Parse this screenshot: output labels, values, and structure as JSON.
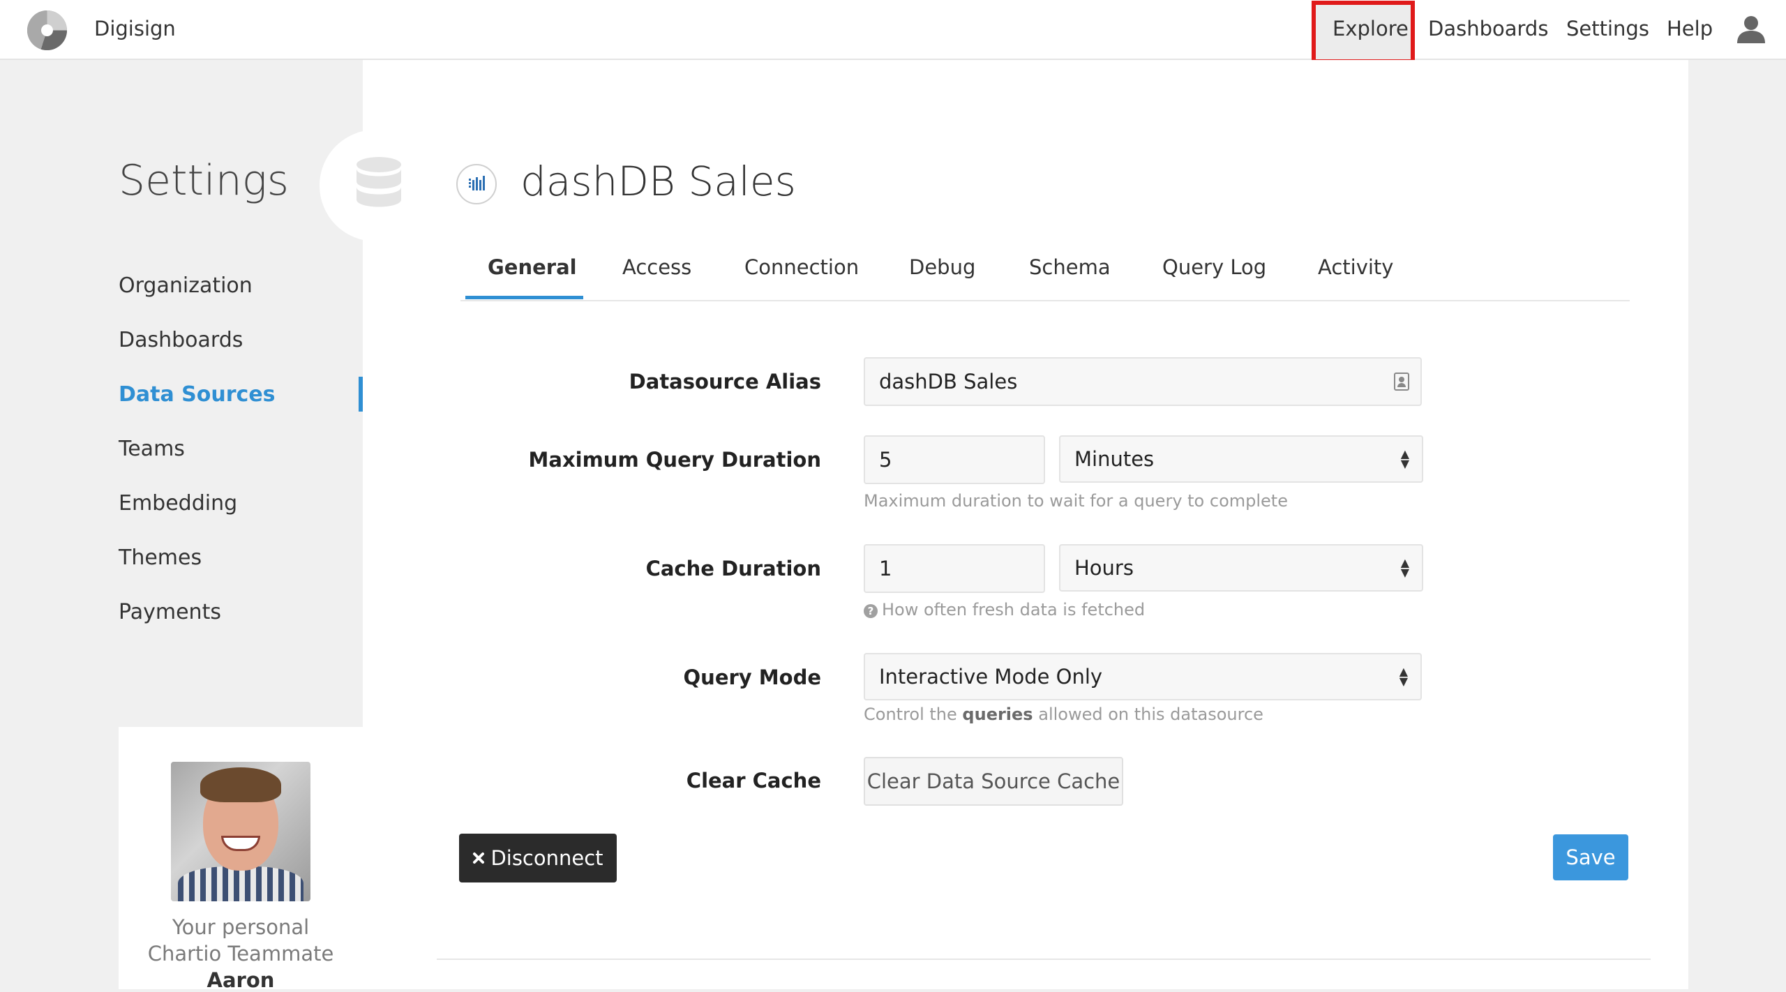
{
  "app": {
    "name": "Digisign"
  },
  "nav": {
    "explore": "Explore",
    "dashboards": "Dashboards",
    "settings": "Settings",
    "help": "Help"
  },
  "sidebar": {
    "title": "Settings",
    "items": [
      {
        "label": "Organization",
        "active": false
      },
      {
        "label": "Dashboards",
        "active": false
      },
      {
        "label": "Data Sources",
        "active": true
      },
      {
        "label": "Teams",
        "active": false
      },
      {
        "label": "Embedding",
        "active": false
      },
      {
        "label": "Themes",
        "active": false
      },
      {
        "label": "Payments",
        "active": false
      }
    ],
    "teammate": {
      "line1": "Your personal",
      "line2": "Chartio Teammate",
      "name": "Aaron"
    }
  },
  "datasource": {
    "title": "dashDB Sales"
  },
  "tabs": [
    {
      "label": "General",
      "active": true
    },
    {
      "label": "Access"
    },
    {
      "label": "Connection"
    },
    {
      "label": "Debug"
    },
    {
      "label": "Schema"
    },
    {
      "label": "Query Log"
    },
    {
      "label": "Activity"
    }
  ],
  "form": {
    "alias": {
      "label": "Datasource Alias",
      "value": "dashDB Sales"
    },
    "max_query": {
      "label": "Maximum Query Duration",
      "value": "5",
      "unit": "Minutes",
      "help": "Maximum duration to wait for a query to complete"
    },
    "cache": {
      "label": "Cache Duration",
      "value": "1",
      "unit": "Hours",
      "help": "How often fresh data is fetched"
    },
    "query_mode": {
      "label": "Query Mode",
      "value": "Interactive Mode Only",
      "help_pre": "Control the",
      "help_bold": "queries",
      "help_post": "allowed on this datasource"
    },
    "clear_cache": {
      "label": "Clear Cache",
      "button": "Clear Data Source Cache"
    }
  },
  "actions": {
    "disconnect": "Disconnect",
    "save": "Save"
  },
  "colors": {
    "accent": "#2f8fd3",
    "highlight_box": "#e01a1a",
    "dark_button": "#2b2b2b",
    "save_button": "#3b97dd"
  }
}
